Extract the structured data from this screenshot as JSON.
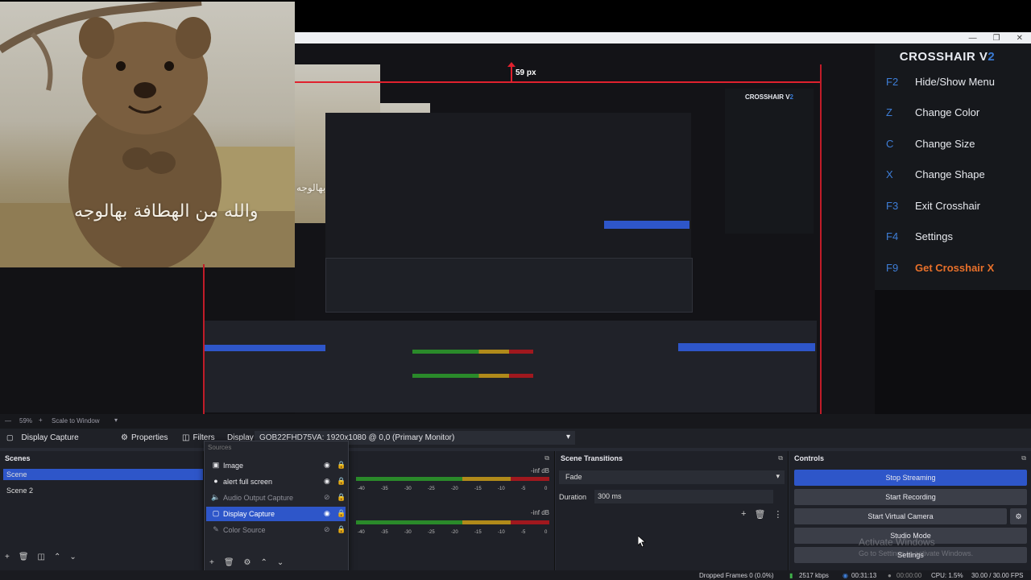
{
  "crosshair_panel": {
    "title_main": "CROSSHAIR V",
    "title_version": "2",
    "items": [
      {
        "key": "F2",
        "label": "Hide/Show Menu"
      },
      {
        "key": "Z",
        "label": "Change Color"
      },
      {
        "key": "C",
        "label": "Change Size"
      },
      {
        "key": "X",
        "label": "Change Shape"
      },
      {
        "key": "F3",
        "label": "Exit Crosshair"
      },
      {
        "key": "F4",
        "label": "Settings"
      },
      {
        "key": "F9",
        "label": "Get Crosshair X"
      }
    ],
    "accent_color": "#3e7ed8",
    "highlight_color": "#e8702a"
  },
  "preview": {
    "measure_label": "59 px",
    "overlay_text": "والله من الهطافة بهالوجه",
    "zoom": "59%",
    "scale_mode": "Scale to Window"
  },
  "toolbar": {
    "source_name": "Display Capture",
    "properties_label": "Properties",
    "filters_label": "Filters",
    "display_label": "Display",
    "display_value": "GOB22FHD75VA: 1920x1080 @ 0,0 (Primary Monitor)"
  },
  "scenes": {
    "title": "Scenes",
    "items": [
      "Scene",
      "Scene 2"
    ]
  },
  "sources": {
    "title": "Sources",
    "items": [
      {
        "label": "Image",
        "icon": "image-icon"
      },
      {
        "label": "alert full screen",
        "icon": "browser-icon"
      },
      {
        "label": "Audio Output Capture",
        "icon": "speaker-icon"
      },
      {
        "label": "Display Capture",
        "icon": "monitor-icon"
      },
      {
        "label": "Color Source",
        "icon": "paint-icon"
      }
    ]
  },
  "mixer": {
    "level_top": "-inf dB",
    "level_bottom": "-inf dB",
    "ticks": [
      "-40",
      "-35",
      "-30",
      "-25",
      "-20",
      "-15",
      "-10",
      "-5",
      "0"
    ]
  },
  "transitions": {
    "title": "Scene Transitions",
    "type": "Fade",
    "duration_label": "Duration",
    "duration_value": "300 ms"
  },
  "controls": {
    "title": "Controls",
    "stop_streaming": "Stop Streaming",
    "start_recording": "Start Recording",
    "start_virtual_camera": "Start Virtual Camera",
    "studio_mode": "Studio Mode",
    "settings": "Settings",
    "active_color": "#2e56c9"
  },
  "watermark": {
    "line1": "Activate Windows",
    "line2": "Go to Settings to activate Windows."
  },
  "statusbar": {
    "dropped_frames": "Dropped Frames 0 (0.0%)",
    "bitrate": "2517 kbps",
    "stream_time": "00:31:13",
    "rec_time": "00:00:00",
    "cpu": "CPU: 1.5%",
    "fps": "30.00 / 30.00 FPS"
  }
}
